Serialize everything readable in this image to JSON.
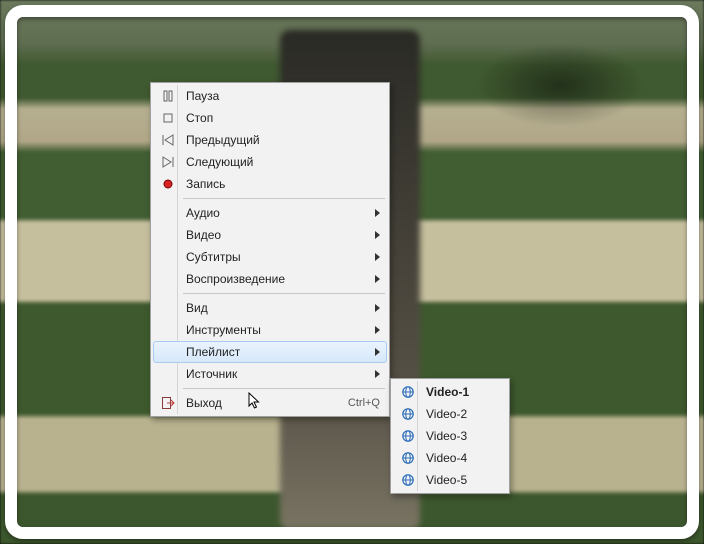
{
  "menu": {
    "items": [
      {
        "icon": "pause",
        "label": "Пауза"
      },
      {
        "icon": "stop",
        "label": "Стоп"
      },
      {
        "icon": "prev",
        "label": "Предыдущий"
      },
      {
        "icon": "next",
        "label": "Следующий"
      },
      {
        "icon": "record",
        "label": "Запись"
      },
      {
        "sep": true
      },
      {
        "label": "Аудио",
        "submenu": true
      },
      {
        "label": "Видео",
        "submenu": true
      },
      {
        "label": "Субтитры",
        "submenu": true
      },
      {
        "label": "Воспроизведение",
        "submenu": true
      },
      {
        "sep": true
      },
      {
        "label": "Вид",
        "submenu": true
      },
      {
        "label": "Инструменты",
        "submenu": true
      },
      {
        "label": "Плейлист",
        "submenu": true,
        "hover": true
      },
      {
        "label": "Источник",
        "submenu": true
      },
      {
        "sep": true
      },
      {
        "icon": "exit",
        "label": "Выход",
        "shortcut": "Ctrl+Q"
      }
    ]
  },
  "submenu": {
    "items": [
      {
        "icon": "globe",
        "label": "Video-1",
        "bold": true
      },
      {
        "icon": "globe",
        "label": "Video-2"
      },
      {
        "icon": "globe",
        "label": "Video-3"
      },
      {
        "icon": "globe",
        "label": "Video-4"
      },
      {
        "icon": "globe",
        "label": "Video-5"
      }
    ]
  }
}
